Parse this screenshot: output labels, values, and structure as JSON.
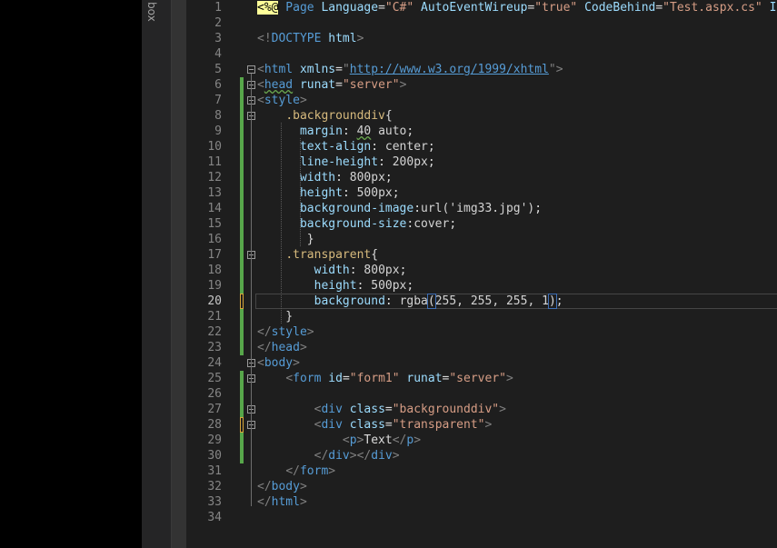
{
  "toolbox": {
    "label": "box"
  },
  "editor": {
    "current_line": "20",
    "lines": [
      {
        "num": "1",
        "tokens": [
          [
            "aspmark",
            "<%@"
          ],
          [
            "aspkw",
            " Page"
          ],
          [
            "attr",
            " Language"
          ],
          [
            "text",
            "="
          ],
          [
            "str",
            "\"C#\""
          ],
          [
            "attr",
            " AutoEventWireup"
          ],
          [
            "text",
            "="
          ],
          [
            "str",
            "\"true\""
          ],
          [
            "attr",
            " CodeBehind"
          ],
          [
            "text",
            "="
          ],
          [
            "str",
            "\"Test.aspx.cs\""
          ],
          [
            "attr",
            " Inh"
          ]
        ]
      },
      {
        "num": "2",
        "tokens": []
      },
      {
        "num": "3",
        "tokens": [
          [
            "delim",
            "<!"
          ],
          [
            "tag",
            "DOCTYPE"
          ],
          [
            "attr",
            " html"
          ],
          [
            "delim",
            ">"
          ]
        ]
      },
      {
        "num": "4",
        "tokens": []
      },
      {
        "num": "5",
        "tokens": [
          [
            "delim",
            "<"
          ],
          [
            "tag",
            "html"
          ],
          [
            "attr",
            " xmlns"
          ],
          [
            "text",
            "="
          ],
          [
            "delim",
            "\""
          ],
          [
            "link",
            "http://www.w3.org/1999/xhtml"
          ],
          [
            "delim",
            "\""
          ],
          [
            "delim",
            ">"
          ]
        ]
      },
      {
        "num": "6",
        "tokens": [
          [
            "delim",
            "<"
          ],
          [
            "tag squiggle",
            "head"
          ],
          [
            "attr",
            " runat"
          ],
          [
            "text",
            "="
          ],
          [
            "str",
            "\"server\""
          ],
          [
            "delim",
            ">"
          ]
        ]
      },
      {
        "num": "7",
        "tokens": [
          [
            "delim",
            "<"
          ],
          [
            "tag",
            "style"
          ],
          [
            "delim",
            ">"
          ]
        ]
      },
      {
        "num": "8",
        "tokens": [
          [
            "text",
            "    "
          ],
          [
            "selector",
            ".backgrounddiv"
          ],
          [
            "text",
            "{"
          ]
        ]
      },
      {
        "num": "9",
        "tokens": [
          [
            "text",
            "      "
          ],
          [
            "prop",
            "margin"
          ],
          [
            "text",
            ": "
          ],
          [
            "val squiggle",
            "40"
          ],
          [
            "val",
            " auto"
          ],
          [
            "text",
            ";"
          ]
        ]
      },
      {
        "num": "10",
        "tokens": [
          [
            "text",
            "      "
          ],
          [
            "prop",
            "text-align"
          ],
          [
            "text",
            ": "
          ],
          [
            "val",
            "center"
          ],
          [
            "text",
            ";"
          ]
        ]
      },
      {
        "num": "11",
        "tokens": [
          [
            "text",
            "      "
          ],
          [
            "prop",
            "line-height"
          ],
          [
            "text",
            ": "
          ],
          [
            "val",
            "200px"
          ],
          [
            "text",
            ";"
          ]
        ]
      },
      {
        "num": "12",
        "tokens": [
          [
            "text",
            "      "
          ],
          [
            "prop",
            "width"
          ],
          [
            "text",
            ": "
          ],
          [
            "val",
            "800px"
          ],
          [
            "text",
            ";"
          ]
        ]
      },
      {
        "num": "13",
        "tokens": [
          [
            "text",
            "      "
          ],
          [
            "prop",
            "height"
          ],
          [
            "text",
            ": "
          ],
          [
            "val",
            "500px"
          ],
          [
            "text",
            ";"
          ]
        ]
      },
      {
        "num": "14",
        "tokens": [
          [
            "text",
            "      "
          ],
          [
            "prop",
            "background-image"
          ],
          [
            "text",
            ":"
          ],
          [
            "val",
            "url('img33.jpg')"
          ],
          [
            "text",
            ";"
          ]
        ]
      },
      {
        "num": "15",
        "tokens": [
          [
            "text",
            "      "
          ],
          [
            "prop",
            "background-size"
          ],
          [
            "text",
            ":"
          ],
          [
            "val",
            "cover"
          ],
          [
            "text",
            ";"
          ]
        ]
      },
      {
        "num": "16",
        "tokens": [
          [
            "text",
            "       }"
          ]
        ]
      },
      {
        "num": "17",
        "tokens": [
          [
            "text",
            "    "
          ],
          [
            "selector",
            ".transparent"
          ],
          [
            "text",
            "{"
          ]
        ]
      },
      {
        "num": "18",
        "tokens": [
          [
            "text",
            "        "
          ],
          [
            "prop",
            "width"
          ],
          [
            "text",
            ": "
          ],
          [
            "val",
            "800px"
          ],
          [
            "text",
            ";"
          ]
        ]
      },
      {
        "num": "19",
        "tokens": [
          [
            "text",
            "        "
          ],
          [
            "prop",
            "height"
          ],
          [
            "text",
            ": "
          ],
          [
            "val",
            "500px"
          ],
          [
            "text",
            ";"
          ]
        ]
      },
      {
        "num": "20",
        "tokens": [
          [
            "text",
            "        "
          ],
          [
            "prop",
            "background"
          ],
          [
            "text",
            ": "
          ],
          [
            "val",
            "rgba"
          ],
          [
            "text bracehl",
            "("
          ],
          [
            "val",
            "255, 255, 255, 1"
          ],
          [
            "text bracehl",
            ")"
          ],
          [
            "text",
            ";"
          ]
        ]
      },
      {
        "num": "21",
        "tokens": [
          [
            "text",
            "    }"
          ]
        ]
      },
      {
        "num": "22",
        "tokens": [
          [
            "delim",
            "</"
          ],
          [
            "tag",
            "style"
          ],
          [
            "delim",
            ">"
          ]
        ]
      },
      {
        "num": "23",
        "tokens": [
          [
            "delim",
            "</"
          ],
          [
            "tag",
            "head"
          ],
          [
            "delim",
            ">"
          ]
        ]
      },
      {
        "num": "24",
        "tokens": [
          [
            "delim",
            "<"
          ],
          [
            "tag",
            "body"
          ],
          [
            "delim",
            ">"
          ]
        ]
      },
      {
        "num": "25",
        "tokens": [
          [
            "text",
            "    "
          ],
          [
            "delim",
            "<"
          ],
          [
            "tag",
            "form"
          ],
          [
            "attr",
            " id"
          ],
          [
            "text",
            "="
          ],
          [
            "str",
            "\"form1\""
          ],
          [
            "attr",
            " runat"
          ],
          [
            "text",
            "="
          ],
          [
            "str",
            "\"server\""
          ],
          [
            "delim",
            ">"
          ]
        ]
      },
      {
        "num": "26",
        "tokens": []
      },
      {
        "num": "27",
        "tokens": [
          [
            "text",
            "        "
          ],
          [
            "delim",
            "<"
          ],
          [
            "tag",
            "div"
          ],
          [
            "attr",
            " class"
          ],
          [
            "text",
            "="
          ],
          [
            "str",
            "\"backgrounddiv\""
          ],
          [
            "delim",
            ">"
          ]
        ]
      },
      {
        "num": "28",
        "tokens": [
          [
            "text",
            "        "
          ],
          [
            "delim",
            "<"
          ],
          [
            "tag",
            "div"
          ],
          [
            "attr",
            " class"
          ],
          [
            "text",
            "="
          ],
          [
            "str",
            "\"transparent\""
          ],
          [
            "delim",
            ">"
          ]
        ]
      },
      {
        "num": "29",
        "tokens": [
          [
            "text",
            "            "
          ],
          [
            "delim",
            "<"
          ],
          [
            "tag",
            "p"
          ],
          [
            "delim",
            ">"
          ],
          [
            "text",
            "Text"
          ],
          [
            "delim",
            "</"
          ],
          [
            "tag",
            "p"
          ],
          [
            "delim",
            ">"
          ]
        ]
      },
      {
        "num": "30",
        "tokens": [
          [
            "text",
            "        "
          ],
          [
            "delim",
            "</"
          ],
          [
            "tag",
            "div"
          ],
          [
            "delim",
            "></"
          ],
          [
            "tag",
            "div"
          ],
          [
            "delim",
            ">"
          ]
        ]
      },
      {
        "num": "31",
        "tokens": [
          [
            "text",
            "    "
          ],
          [
            "delim",
            "</"
          ],
          [
            "tag",
            "form"
          ],
          [
            "delim",
            ">"
          ]
        ]
      },
      {
        "num": "32",
        "tokens": [
          [
            "delim",
            "</"
          ],
          [
            "tag",
            "body"
          ],
          [
            "delim",
            ">"
          ]
        ]
      },
      {
        "num": "33",
        "tokens": [
          [
            "delim",
            "</"
          ],
          [
            "tag",
            "html"
          ],
          [
            "delim",
            ">"
          ]
        ]
      },
      {
        "num": "34",
        "tokens": []
      }
    ],
    "change_markers": {
      "saved": [
        "6",
        "7",
        "8",
        "9",
        "10",
        "11",
        "12",
        "13",
        "14",
        "15",
        "16",
        "17",
        "18",
        "19",
        "21",
        "22",
        "23",
        "25",
        "26",
        "27",
        "29",
        "30"
      ],
      "unsaved": [
        "20",
        "28"
      ]
    },
    "fold_markers": [
      "5",
      "6",
      "7",
      "8",
      "17",
      "24",
      "25",
      "27",
      "28"
    ]
  },
  "colors": {
    "editor_bg": "#1e1e1e",
    "tag": "#569cd6",
    "attribute": "#9cdcfe",
    "string": "#d69d85",
    "css_selector": "#d7ba7d",
    "change_saved": "#57a64a",
    "change_unsaved": "#d7a53a"
  }
}
